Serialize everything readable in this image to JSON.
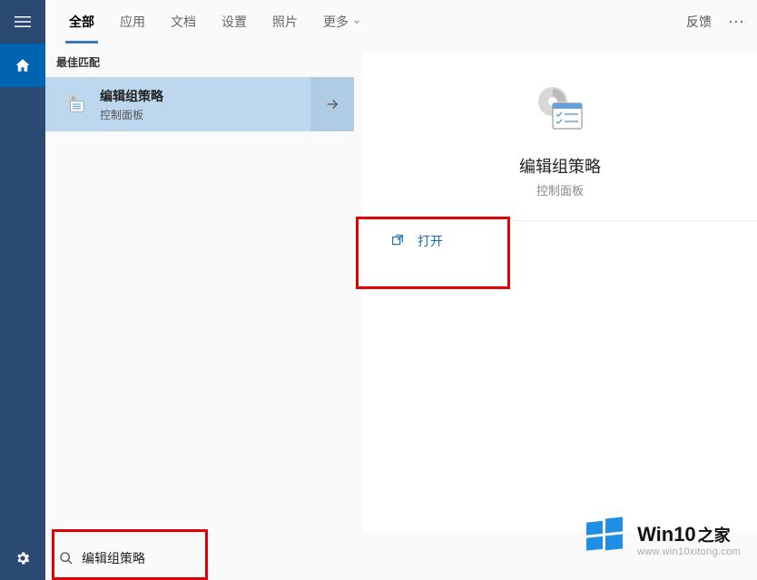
{
  "sidebar": {
    "menu_icon": "hamburger-icon",
    "home_icon": "home-icon",
    "settings_icon": "gear-icon"
  },
  "tabs": {
    "items": [
      "全部",
      "应用",
      "文档",
      "设置",
      "照片",
      "更多"
    ],
    "active_index": 0,
    "feedback": "反馈"
  },
  "results": {
    "section": "最佳匹配",
    "item": {
      "title": "编辑组策略",
      "subtitle": "控制面板"
    }
  },
  "detail": {
    "title": "编辑组策略",
    "subtitle": "控制面板",
    "open_label": "打开"
  },
  "search": {
    "value": "编辑组策略"
  },
  "watermark": {
    "title_bold": "Win10",
    "title_suffix": "之家",
    "url": "www.win10xitong.com"
  }
}
